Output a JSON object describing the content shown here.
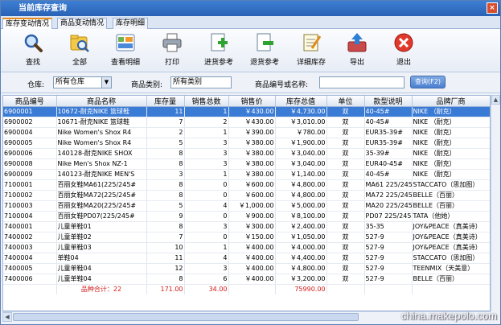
{
  "window": {
    "title": "当前库存查询",
    "close_label": "×"
  },
  "tabs": [
    {
      "label": "库存变动情况"
    },
    {
      "label": "商品变动情况"
    },
    {
      "label": "库存明细"
    }
  ],
  "toolbar": [
    {
      "label": "查找",
      "icon": "magnifier-icon"
    },
    {
      "label": "全部",
      "icon": "folder-search-icon"
    },
    {
      "label": "查看明细",
      "icon": "details-icon"
    },
    {
      "label": "打印",
      "icon": "printer-icon"
    },
    {
      "label": "进货参考",
      "icon": "document-add-icon"
    },
    {
      "label": "退货参考",
      "icon": "document-remove-icon"
    },
    {
      "label": "详细库存",
      "icon": "notepad-icon"
    },
    {
      "label": "导出",
      "icon": "export-icon"
    },
    {
      "label": "退出",
      "icon": "exit-icon"
    }
  ],
  "filters": {
    "warehouse_label": "仓库:",
    "warehouse_value": "所有仓库",
    "category_label": "商品类别:",
    "category_value": "所有类别",
    "code_label": "商品编号或名称:",
    "code_value": "",
    "query_button": "查询(F2)"
  },
  "grid": {
    "columns": [
      "商品编号",
      "商品名称",
      "库存量",
      "销售总数",
      "销售价",
      "库存总值",
      "单位",
      "款型说明",
      "品牌厂商"
    ],
    "rows": [
      [
        "6900001",
        "10672-耐克NIKE 篮球鞋",
        "11",
        "1",
        "￥430.00",
        "￥4,730.00",
        "双",
        "40-45#",
        "NIKE （耐克）"
      ],
      [
        "6900002",
        "10671-耐克NIKE 篮球鞋",
        "7",
        "2",
        "￥430.00",
        "￥3,010.00",
        "双",
        "40-45#",
        "NIKE （耐克）"
      ],
      [
        "6900004",
        "Nike Women's Shox R4",
        "2",
        "1",
        "￥390.00",
        "￥780.00",
        "双",
        "EUR35-39#",
        "NIKE （耐克）"
      ],
      [
        "6900005",
        "Nike Women's Shox R4",
        "5",
        "3",
        "￥380.00",
        "￥1,900.00",
        "双",
        "EUR35-39#",
        "NIKE （耐克）"
      ],
      [
        "6900006",
        "140128-耐克NIKE SHOX",
        "8",
        "3",
        "￥380.00",
        "￥3,040.00",
        "双",
        "35-39#",
        "NIKE （耐克）"
      ],
      [
        "6900008",
        "Nike Men's Shox NZ-1",
        "8",
        "3",
        "￥380.00",
        "￥3,040.00",
        "双",
        "EUR40-45#",
        "NIKE （耐克）"
      ],
      [
        "6900009",
        "140123-耐克NIKE MEN'S",
        "3",
        "1",
        "￥380.00",
        "￥1,140.00",
        "双",
        "40-45#",
        "NIKE （耐克）"
      ],
      [
        "7100001",
        "百丽女鞋MA61(225/245#",
        "8",
        "0",
        "￥600.00",
        "￥4,800.00",
        "双",
        "MA61 225/245",
        "STACCATO（思加图）"
      ],
      [
        "7100002",
        "百丽女鞋MA72(225/245#",
        "8",
        "0",
        "￥600.00",
        "￥4,800.00",
        "双",
        "MA72 225/245",
        "BELLE（百丽）"
      ],
      [
        "7100003",
        "百丽女鞋MA20(225/245#",
        "5",
        "4",
        "￥1,000.00",
        "￥5,000.00",
        "双",
        "MA20 225/245",
        "BELLE（百丽）"
      ],
      [
        "7100004",
        "百丽女鞋PD07(225/245#",
        "9",
        "0",
        "￥900.00",
        "￥8,100.00",
        "双",
        "PD07 225/245",
        "TATA（他她）"
      ],
      [
        "7400001",
        "儿童单鞋01",
        "8",
        "3",
        "￥300.00",
        "￥2,400.00",
        "双",
        "35-35",
        "JOY&PEACE（真美诗）"
      ],
      [
        "7400002",
        "儿童单鞋02",
        "7",
        "0",
        "￥150.00",
        "￥1,050.00",
        "双",
        "527-9",
        "JOY&PEACE（真美诗）"
      ],
      [
        "7400003",
        "儿童单鞋03",
        "10",
        "1",
        "￥400.00",
        "￥4,000.00",
        "双",
        "527-9",
        "JOY&PEACE（真美诗）"
      ],
      [
        "7400004",
        "单鞋04",
        "11",
        "4",
        "￥400.00",
        "￥4,400.00",
        "双",
        "527-9",
        "STACCATO（思加图）"
      ],
      [
        "7400005",
        "儿童单鞋04",
        "12",
        "3",
        "￥400.00",
        "￥4,800.00",
        "双",
        "527-9",
        "TEENMIX（天美意）"
      ],
      [
        "7400006",
        "儿童单鞋04",
        "8",
        "6",
        "￥400.00",
        "￥3,200.00",
        "双",
        "527-9",
        "BELLE（百丽）"
      ]
    ],
    "selected_row": 0,
    "totals": {
      "label": "品种合计：22",
      "stock": "171.00",
      "sales": "34.00",
      "value": "75990.00"
    }
  },
  "watermark": "china.makepolo.com"
}
